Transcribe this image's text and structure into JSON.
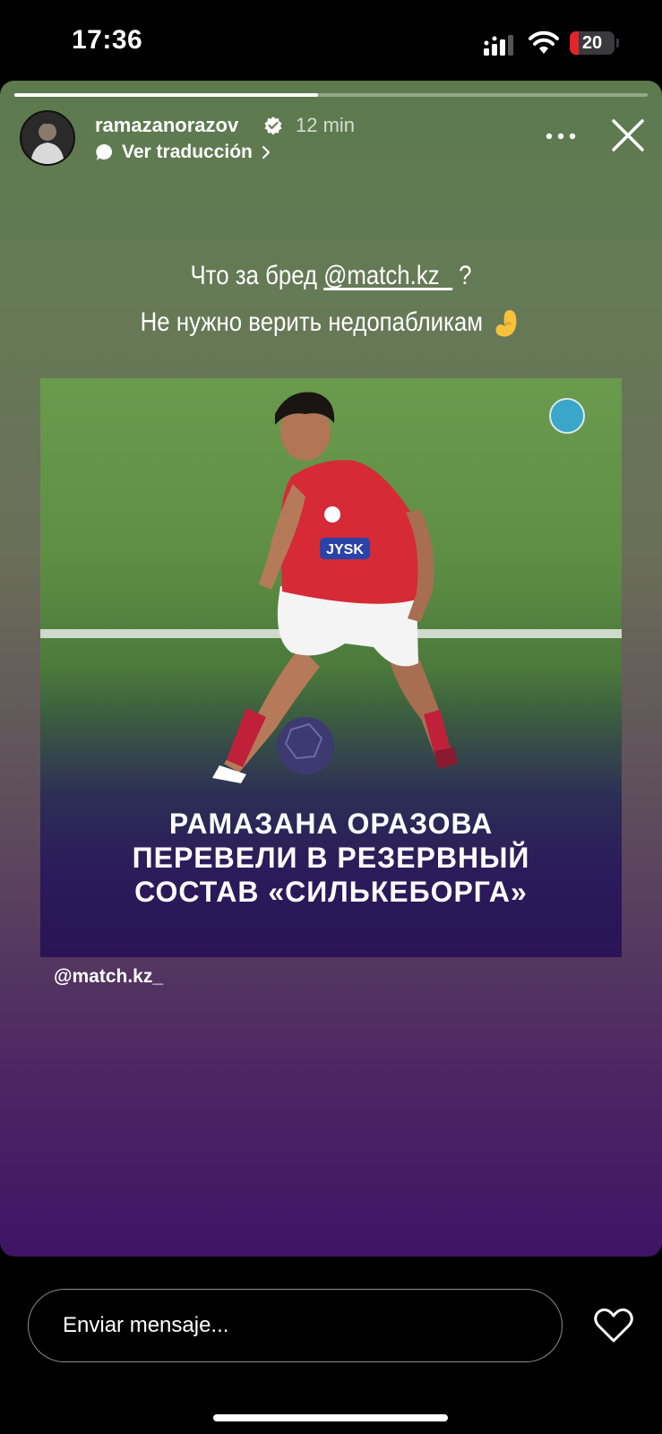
{
  "status_bar": {
    "time": "17:36",
    "battery_level": "20",
    "battery_fraction": 0.2,
    "battery_color": "#e0262b"
  },
  "story": {
    "progress": 0.48,
    "username": "ramazanorazov",
    "verified": true,
    "posted_ago": "12 min",
    "translate_label": "Ver traducción",
    "caption_line1_pre": "Что за бред ",
    "caption_mention": "@match.kz_",
    "caption_line1_post": " ?",
    "caption_line2": "Не нужно верить недопабликам",
    "caption_emoji": "pinched-fingers-emoji",
    "post_image": {
      "jersey_sponsor": "JYSK",
      "headline_line1": "РАМАЗАНА ОРАЗОВА",
      "headline_line2": "ПЕРЕВЕЛИ В РЕЗЕРВНЫЙ",
      "headline_line3": "СОСТАВ «СИЛЬКЕБОРГА»"
    },
    "source_tag": "@match.kz_"
  },
  "message_bar": {
    "placeholder": "Enviar mensaje..."
  },
  "icons": {
    "more": "more-options-icon",
    "close": "close-icon",
    "like": "heart-icon"
  }
}
